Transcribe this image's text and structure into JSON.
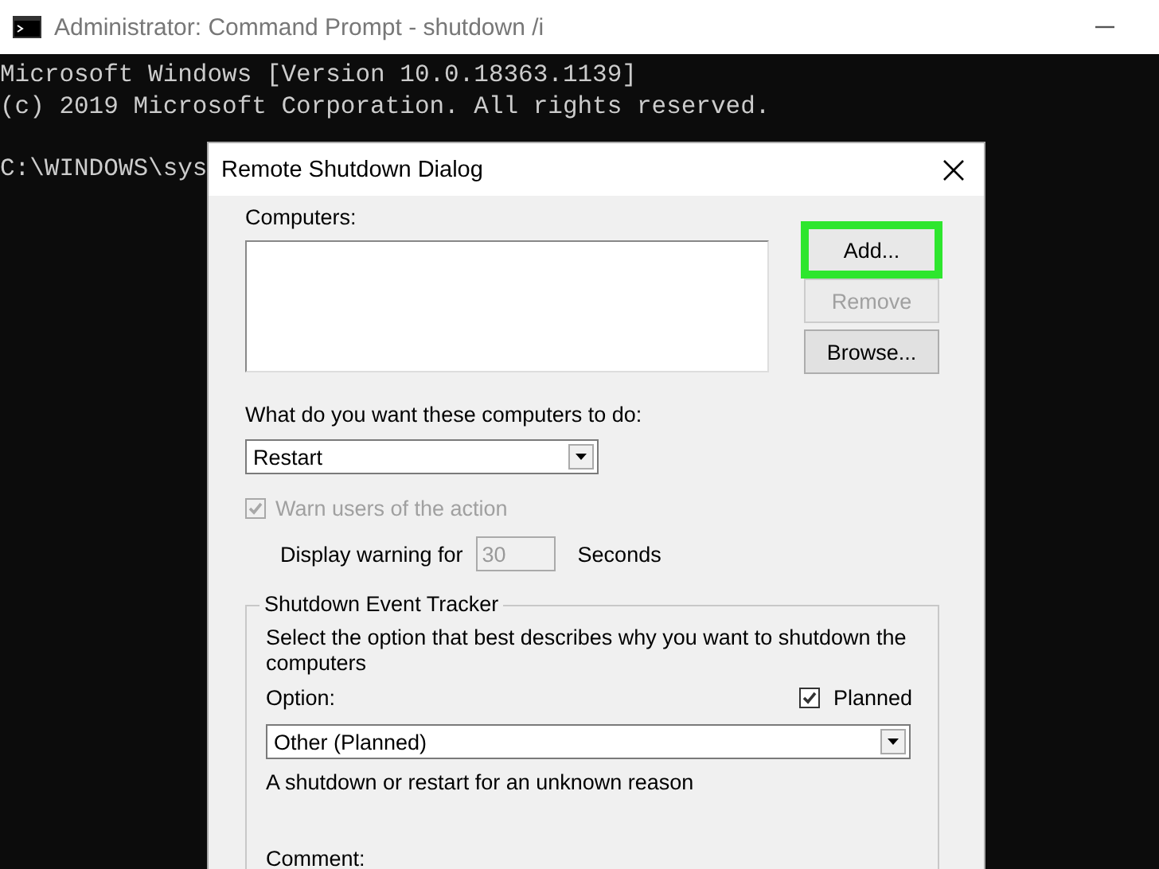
{
  "window": {
    "title": "Administrator: Command Prompt - shutdown  /i"
  },
  "console": {
    "lines": [
      "Microsoft Windows [Version 10.0.18363.1139]",
      "(c) 2019 Microsoft Corporation. All rights reserved.",
      "C:\\WINDOWS\\sys"
    ]
  },
  "dialog": {
    "title": "Remote Shutdown Dialog",
    "computers_label": "Computers:",
    "buttons": [
      {
        "label": "Add...",
        "disabled": false,
        "highlighted": true
      },
      {
        "label": "Remove",
        "disabled": true,
        "highlighted": false
      },
      {
        "label": "Browse...",
        "disabled": false,
        "highlighted": false
      }
    ],
    "action_label": "What do you want these computers to do:",
    "action_value": "Restart",
    "warn": {
      "label": "Warn users of the action",
      "checked": true,
      "disabled": true
    },
    "warning_label": "Display warning for",
    "warning_value": "30",
    "warning_unit": "Seconds",
    "tracker": {
      "title": "Shutdown Event Tracker",
      "instructions": "Select the option that best describes why you want to shutdown the computers",
      "option_label": "Option:",
      "planned": {
        "label": "Planned",
        "checked": true
      },
      "option_value": "Other (Planned)",
      "description": "A shutdown or restart for an unknown reason",
      "comment_label": "Comment:"
    }
  }
}
